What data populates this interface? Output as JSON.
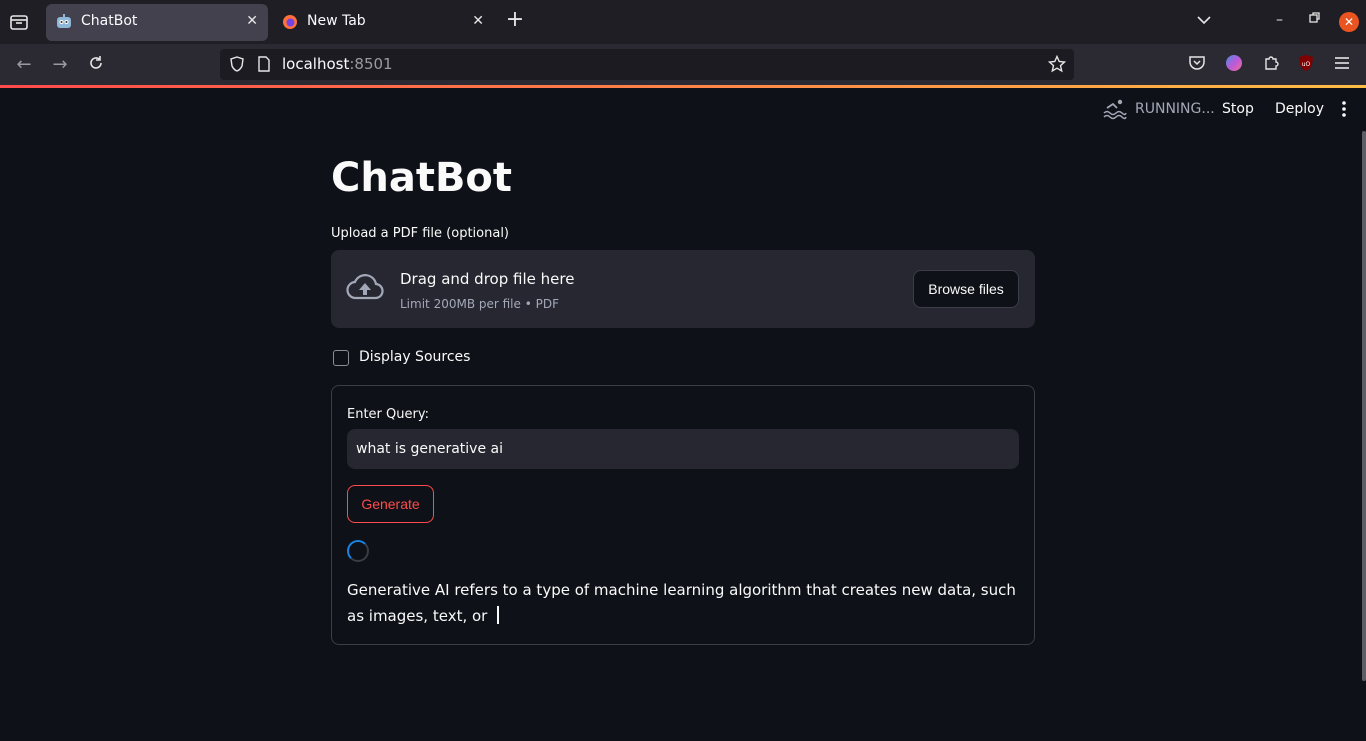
{
  "browser": {
    "tabs": [
      {
        "title": "ChatBot",
        "active": true
      },
      {
        "title": "New Tab",
        "active": false
      }
    ],
    "url_host": "localhost",
    "url_port": ":8501"
  },
  "app_header": {
    "status": "RUNNING...",
    "stop_label": "Stop",
    "deploy_label": "Deploy"
  },
  "page": {
    "title": "ChatBot",
    "upload": {
      "label": "Upload a PDF file (optional)",
      "drop_title": "Drag and drop file here",
      "drop_sub": "Limit 200MB per file • PDF",
      "browse_label": "Browse files"
    },
    "checkbox": {
      "label": "Display Sources",
      "checked": false
    },
    "form": {
      "query_label": "Enter Query:",
      "query_value": "what is generative ai",
      "generate_label": "Generate",
      "answer": "Generative AI refers to a type of machine learning algorithm that creates new data, such as images, text, or"
    }
  },
  "colors": {
    "accent": "#ff4b4b",
    "background": "#0e1117",
    "widget": "#262730",
    "spinner": "#1c83e1"
  }
}
